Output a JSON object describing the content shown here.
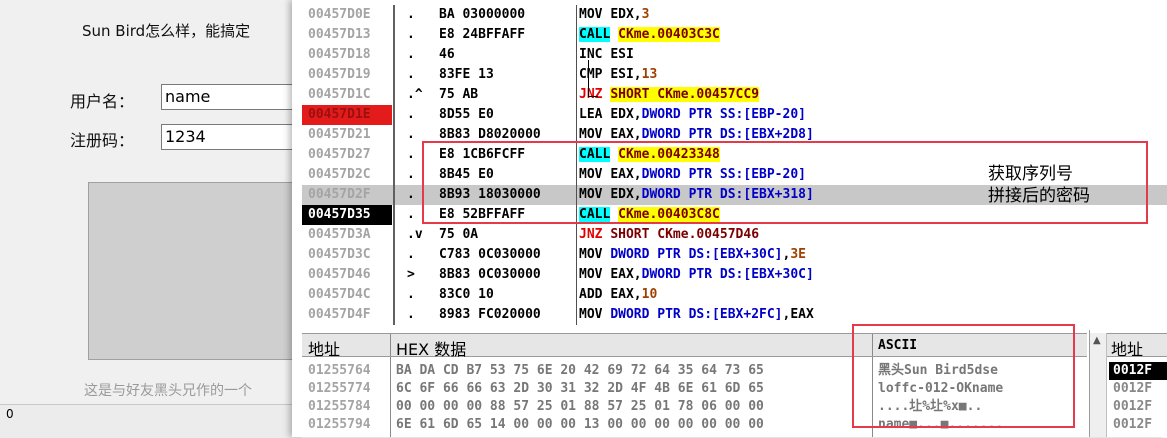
{
  "crackme": {
    "description": "Sun Bird怎么样，能搞定",
    "username_label": "用户名：",
    "username_value": "name",
    "serial_label": "注册码：",
    "serial_value": "1234",
    "footer_text": "这是与好友黑头兄作的一个",
    "status_text": "0"
  },
  "disasm": {
    "rows": [
      {
        "addr": "00457D0E",
        "mark": ".",
        "hex": "BA 03000000",
        "mnemonic": "MOV",
        "operands": "EDX,3"
      },
      {
        "addr": "00457D13",
        "mark": ".",
        "hex": "E8 24BFFAFF",
        "mnemonic": "CALL",
        "operands": "CKme.00403C3C"
      },
      {
        "addr": "00457D18",
        "mark": ".",
        "hex": "46",
        "mnemonic": "INC",
        "operands": "ESI"
      },
      {
        "addr": "00457D19",
        "mark": ".",
        "hex": "83FE 13",
        "mnemonic": "CMP",
        "operands": "ESI,13"
      },
      {
        "addr": "00457D1C",
        "mark": ".^",
        "hex": "75 AB",
        "mnemonic": "JNZ",
        "operands": "SHORT CKme.00457CC9"
      },
      {
        "addr": "00457D1E",
        "mark": ".",
        "hex": "8D55 E0",
        "mnemonic": "LEA",
        "operands": "EDX,DWORD PTR SS:[EBP-20]"
      },
      {
        "addr": "00457D21",
        "mark": ".",
        "hex": "8B83 D8020000",
        "mnemonic": "MOV",
        "operands": "EAX,DWORD PTR DS:[EBX+2D8]"
      },
      {
        "addr": "00457D27",
        "mark": ".",
        "hex": "E8 1CB6FCFF",
        "mnemonic": "CALL",
        "operands": "CKme.00423348"
      },
      {
        "addr": "00457D2C",
        "mark": ".",
        "hex": "8B45 E0",
        "mnemonic": "MOV",
        "operands": "EAX,DWORD PTR SS:[EBP-20]"
      },
      {
        "addr": "00457D2F",
        "mark": ".",
        "hex": "8B93 18030000",
        "mnemonic": "MOV",
        "operands": "EDX,DWORD PTR DS:[EBX+318]"
      },
      {
        "addr": "00457D35",
        "mark": ".",
        "hex": "E8 52BFFAFF",
        "mnemonic": "CALL",
        "operands": "CKme.00403C8C"
      },
      {
        "addr": "00457D3A",
        "mark": ".v",
        "hex": "75 0A",
        "mnemonic": "JNZ",
        "operands": "SHORT CKme.00457D46"
      },
      {
        "addr": "00457D3C",
        "mark": ".",
        "hex": "C783 0C030000",
        "mnemonic": "MOV",
        "operands": "DWORD PTR DS:[EBX+30C],3E"
      },
      {
        "addr": "00457D46",
        "mark": ">",
        "hex": "8B83 0C030000",
        "mnemonic": "MOV",
        "operands": "EAX,DWORD PTR DS:[EBX+30C]"
      },
      {
        "addr": "00457D4C",
        "mark": ".",
        "hex": "83C0 10",
        "mnemonic": "ADD",
        "operands": "EAX,10"
      },
      {
        "addr": "00457D4F",
        "mark": ".",
        "hex": "8983 FC020000",
        "mnemonic": "MOV",
        "operands": "DWORD PTR DS:[EBX+2FC],EAX"
      }
    ],
    "comment_line1": "获取序列号",
    "comment_line2": "拼接后的密码"
  },
  "dump": {
    "header_address": "地址",
    "header_hex": "HEX 数据",
    "header_ascii": "ASCII",
    "rows": [
      {
        "addr": "01255764",
        "hex": "BA DA CD B7 53 75 6E 20 42 69 72 64 35 64 73 65",
        "ascii": "黑头Sun Bird5dse"
      },
      {
        "addr": "01255774",
        "hex": "6C 6F 66 66 63 2D 30 31 32 2D 4F 4B 6E 61 6D 65",
        "ascii": "loffc-012-OKname"
      },
      {
        "addr": "01255784",
        "hex": "00 00 00 00 88 57 25 01 88 57 25 01 78 06 00 00",
        "ascii": "....圵%圵%x■.."
      },
      {
        "addr": "01255794",
        "hex": "6E 61 6D 65 14 00 00 00 13 00 00 00 00 00 00 00",
        "ascii": "name■...■......."
      }
    ]
  },
  "stack": {
    "header": "地址",
    "rows": [
      "0012F",
      "0012F",
      "0012F",
      "0012F"
    ]
  },
  "colors": {
    "breakpoint": "#e41b1b",
    "call_highlight": "#00ffff",
    "target_highlight": "#ffff00",
    "annotation_box": "#e53a4a"
  }
}
